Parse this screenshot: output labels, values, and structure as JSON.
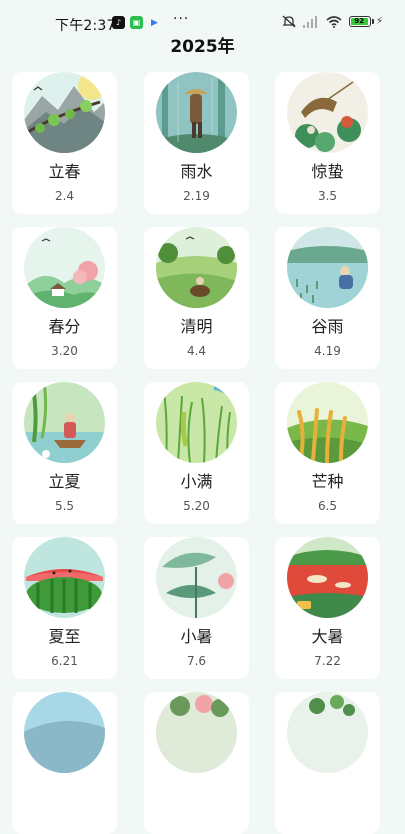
{
  "status_bar": {
    "time": "下午2:37",
    "battery": "92",
    "battery_level": 0.92
  },
  "page": {
    "title": "2025年"
  },
  "terms": [
    {
      "name": "立春",
      "date": "2.4"
    },
    {
      "name": "雨水",
      "date": "2.19"
    },
    {
      "name": "惊蛰",
      "date": "3.5"
    },
    {
      "name": "春分",
      "date": "3.20"
    },
    {
      "name": "清明",
      "date": "4.4"
    },
    {
      "name": "谷雨",
      "date": "4.19"
    },
    {
      "name": "立夏",
      "date": "5.5"
    },
    {
      "name": "小满",
      "date": "5.20"
    },
    {
      "name": "芒种",
      "date": "6.5"
    },
    {
      "name": "夏至",
      "date": "6.21"
    },
    {
      "name": "小暑",
      "date": "7.6"
    },
    {
      "name": "大暑",
      "date": "7.22"
    },
    {
      "name": "",
      "date": ""
    },
    {
      "name": "",
      "date": ""
    },
    {
      "name": "",
      "date": ""
    }
  ],
  "colors": {
    "page_background": "#f1f8f5",
    "card_background": "#ffffff"
  }
}
